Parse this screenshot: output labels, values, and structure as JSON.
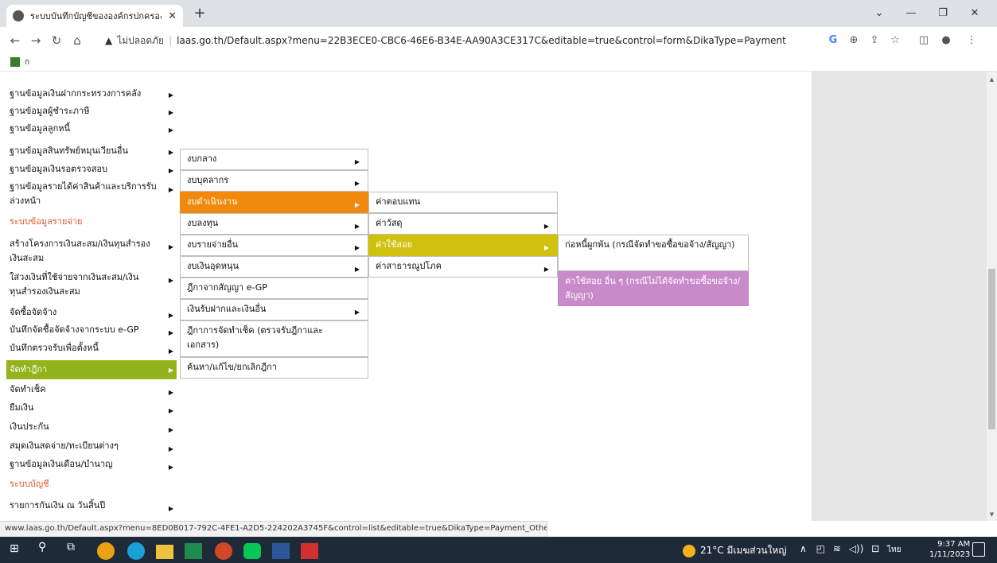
{
  "browser": {
    "tab_title": "ระบบบันทึกบัญชีขององค์กรปกครองส่วน",
    "tab_close": "✕",
    "new_tab": "+",
    "security": "ไม่ปลอดภัย",
    "url": "laas.go.th/Default.aspx?menu=22B3ECE0-CBC6-46E6-B34E-AA90A3CE317C&editable=true&control=form&DikaType=Payment",
    "bookmark_label": "ก"
  },
  "left_menu": [
    {
      "label": "ฐานข้อมูลเงินฝากกระทรวงการคลัง",
      "arrow": "▶"
    },
    {
      "label": "ฐานข้อมูลผู้ชำระภาษี",
      "arrow": "▶"
    },
    {
      "label": "ฐานข้อมูลลูกหนี้",
      "arrow": "▶"
    },
    {
      "label": "ฐานข้อมูลสินทรัพย์หมุนเวียนอื่น",
      "arrow": "▶"
    },
    {
      "label": "ฐานข้อมูลเงินรอตรวจสอบ",
      "arrow": "▶"
    },
    {
      "label": "ฐานข้อมูลรายได้ค่าสินค้าและบริการรับล่วงหน้า",
      "arrow": "▶"
    },
    {
      "label": "ระบบข้อมูลรายจ่าย",
      "arrow": ""
    },
    {
      "label": "สร้างโครงการเงินสะสม/เงินทุนสำรองเงินสะสม",
      "arrow": "▶"
    },
    {
      "label": "ใส่วงเงินที่ใช้จ่ายจากเงินสะสม/เงินทุนสำรองเงินสะสม",
      "arrow": "▶"
    },
    {
      "label": "จัดซื้อจัดจ้าง",
      "arrow": "▶"
    },
    {
      "label": "บันทึกจัดซื้อจัดจ้างจากระบบ e-GP",
      "arrow": "▶"
    },
    {
      "label": "บันทึกตรวจรับเพื่อตั้งหนี้",
      "arrow": "▶"
    },
    {
      "label": "จัดทำฎีกา",
      "arrow": "▶"
    },
    {
      "label": "จัดทำเช็ค",
      "arrow": "▶"
    },
    {
      "label": "ยืมเงิน",
      "arrow": "▶"
    },
    {
      "label": "เงินประกัน",
      "arrow": "▶"
    },
    {
      "label": "สมุดเงินสดจ่าย/ทะเบียนต่างๆ",
      "arrow": "▶"
    },
    {
      "label": "ฐานข้อมูลเงินเดือน/บำนาญ",
      "arrow": "▶"
    },
    {
      "label": "ระบบบัญชี",
      "arrow": ""
    },
    {
      "label": "รายการกันเงิน ณ วันสิ้นปี",
      "arrow": "▶"
    }
  ],
  "submenu1": [
    {
      "label": "งบกลาง",
      "arrow": "▶"
    },
    {
      "label": "งบบุคลากร",
      "arrow": "▶"
    },
    {
      "label": "งบดำเนินงาน",
      "arrow": "▶"
    },
    {
      "label": "งบลงทุน",
      "arrow": "▶"
    },
    {
      "label": "งบรายจ่ายอื่น",
      "arrow": "▶"
    },
    {
      "label": "งบเงินอุดหนุน",
      "arrow": "▶"
    },
    {
      "label": "ฎีกาจากสัญญา e-GP",
      "arrow": ""
    },
    {
      "label": "เงินรับฝากและเงินอื่น",
      "arrow": "▶"
    },
    {
      "label": "ฎีกาการจัดทำเช็ค (ตรวจรับฎีกาและเอกสาร)",
      "arrow": ""
    },
    {
      "label": "ค้นหา/แก้ไข/ยกเลิกฎีกา",
      "arrow": ""
    }
  ],
  "submenu2": [
    {
      "label": "ค่าตอบแทน",
      "arrow": ""
    },
    {
      "label": "ค่าวัสดุ",
      "arrow": "▶"
    },
    {
      "label": "ค่าใช้สอย",
      "arrow": "▶"
    },
    {
      "label": "ค่าสาธารณูปโภค",
      "arrow": "▶"
    }
  ],
  "submenu3": [
    {
      "label": "ก่อหนี้ผูกพัน (กรณีจัดทำขอซื้อขอจ้าง/สัญญา)"
    },
    {
      "label": "ค่าใช้สอย อื่น ๆ (กรณีไม่ได้จัดทำขอซื้อขอจ้าง/สัญญา)"
    }
  ],
  "status_url": "www.laas.go.th/Default.aspx?menu=8ED0B017-792C-4FE1-A2D5-224202A3745F&control=list&editable=true&DikaType=Payment_Other",
  "taskbar": {
    "weather": "21°C มีเมฆส่วนใหญ่",
    "lang": "ไทย",
    "time": "9:37 AM",
    "date": "1/11/2023"
  },
  "colors": {
    "menu_active": "#92b31a",
    "menu_header": "#e0562a",
    "submenu_orange": "#f0890c",
    "submenu_olive": "#cfc10d",
    "submenu_pink": "#c98ac9"
  }
}
